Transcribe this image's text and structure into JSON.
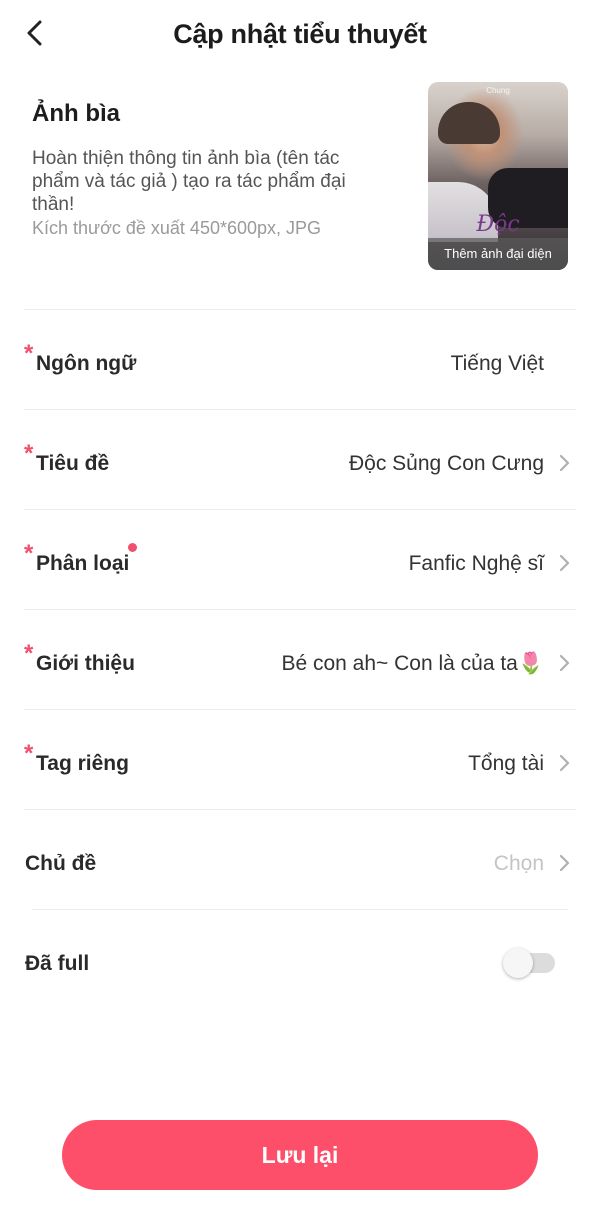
{
  "header": {
    "title": "Cập nhật tiểu thuyết"
  },
  "cover": {
    "title": "Ảnh bìa",
    "description": "Hoàn thiện thông tin ảnh bìa (tên tác phẩm và tác giả ) tạo ra tác phẩm đại thần!",
    "hint": "Kích thước đề xuất 450*600px, JPG",
    "image_caption": "Chung",
    "image_title": "Độc",
    "add_label": "Thêm ảnh đại diện"
  },
  "fields": [
    {
      "label": "Ngôn ngữ",
      "value": "Tiếng Việt",
      "required": true,
      "chevron": false
    },
    {
      "label": "Tiêu đề",
      "value": "Độc Sủng Con Cưng",
      "required": true,
      "chevron": true
    },
    {
      "label": "Phân loại",
      "value": "Fanfic Nghệ sĩ",
      "required": true,
      "chevron": true,
      "dot": true
    },
    {
      "label": "Giới thiệu",
      "value": "Bé con ah~ Con là của ta🌷",
      "required": true,
      "chevron": true
    },
    {
      "label": "Tag riêng",
      "value": "Tổng tài",
      "required": true,
      "chevron": true
    },
    {
      "label": "Chủ đề",
      "value": "Chọn",
      "required": false,
      "chevron": true,
      "placeholder": true
    }
  ],
  "full_toggle": {
    "label": "Đã full",
    "on": false
  },
  "save_button": {
    "label": "Lưu lại"
  },
  "colors": {
    "accent": "#fd4f6a",
    "required": "#f0506b"
  }
}
